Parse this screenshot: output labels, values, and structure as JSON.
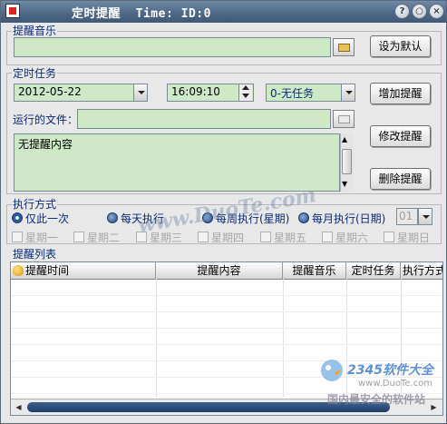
{
  "window": {
    "title": "定时提醒  Time: ID:0"
  },
  "title_buttons": {
    "help": "?",
    "minimize": "○",
    "close": "×"
  },
  "music": {
    "section_label": "提醒音乐",
    "path_value": "",
    "default_button": "设为默认"
  },
  "task": {
    "section_label": "定时任务",
    "date": "2012-05-22",
    "time": "16:09:10",
    "task_type": "0-无任务",
    "add_button": "增加提醒",
    "file_label": "运行的文件：",
    "file_value": "",
    "content": "无提醒内容",
    "modify_button": "修改提醒",
    "delete_button": "删除提醒"
  },
  "mode": {
    "section_label": "执行方式",
    "options": [
      {
        "label": "仅此一次",
        "selected": true
      },
      {
        "label": "每天执行",
        "selected": false
      },
      {
        "label": "每周执行(星期)",
        "selected": false
      },
      {
        "label": "每月执行(日期)",
        "selected": false
      }
    ],
    "day_value": "01",
    "weekdays": [
      "星期一",
      "星期二",
      "星期三",
      "星期四",
      "星期五",
      "星期六",
      "星期日"
    ]
  },
  "list": {
    "section_label": "提醒列表",
    "columns": [
      "提醒时间",
      "提醒内容",
      "提醒音乐",
      "定时任务",
      "执行方式"
    ]
  },
  "watermarks": {
    "center": "www.DuoTe.com",
    "logo_text": "2345软件大全",
    "logo_url": "www.DuoTe.com",
    "footer": "国内最安全的软件站"
  },
  "colors": {
    "field_bg": "#cde9c6",
    "title_bar": "#4c6785",
    "label_blue": "#0a2a7a"
  }
}
